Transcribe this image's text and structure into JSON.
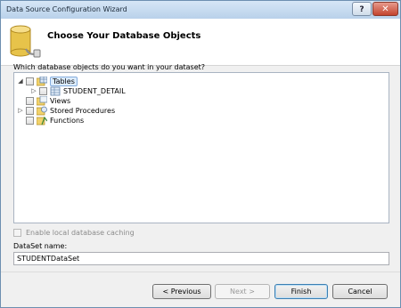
{
  "window": {
    "title": "Data Source Configuration Wizard",
    "help_label": "?",
    "close_label": "✕"
  },
  "header": {
    "title": "Choose Your Database Objects"
  },
  "prompt": {
    "question": "Which database objects do you want in your dataset?"
  },
  "tree": {
    "tables": {
      "label": "Tables",
      "expanded": true,
      "selected": true
    },
    "student_detail": {
      "label": "STUDENT_DETAIL",
      "expanded": false
    },
    "views": {
      "label": "Views"
    },
    "stored_procedures": {
      "label": "Stored Procedures",
      "expanded": false
    },
    "functions": {
      "label": "Functions"
    }
  },
  "caching": {
    "label": "Enable local database caching",
    "checked": false,
    "enabled": false
  },
  "dataset": {
    "label": "DataSet name:",
    "value": "STUDENTDataSet"
  },
  "buttons": {
    "previous": "< Previous",
    "next": "Next >",
    "finish": "Finish",
    "cancel": "Cancel"
  },
  "colors": {
    "selection": "#dcecfc",
    "titlebar": "#b9d1ea",
    "close": "#c3442f"
  }
}
